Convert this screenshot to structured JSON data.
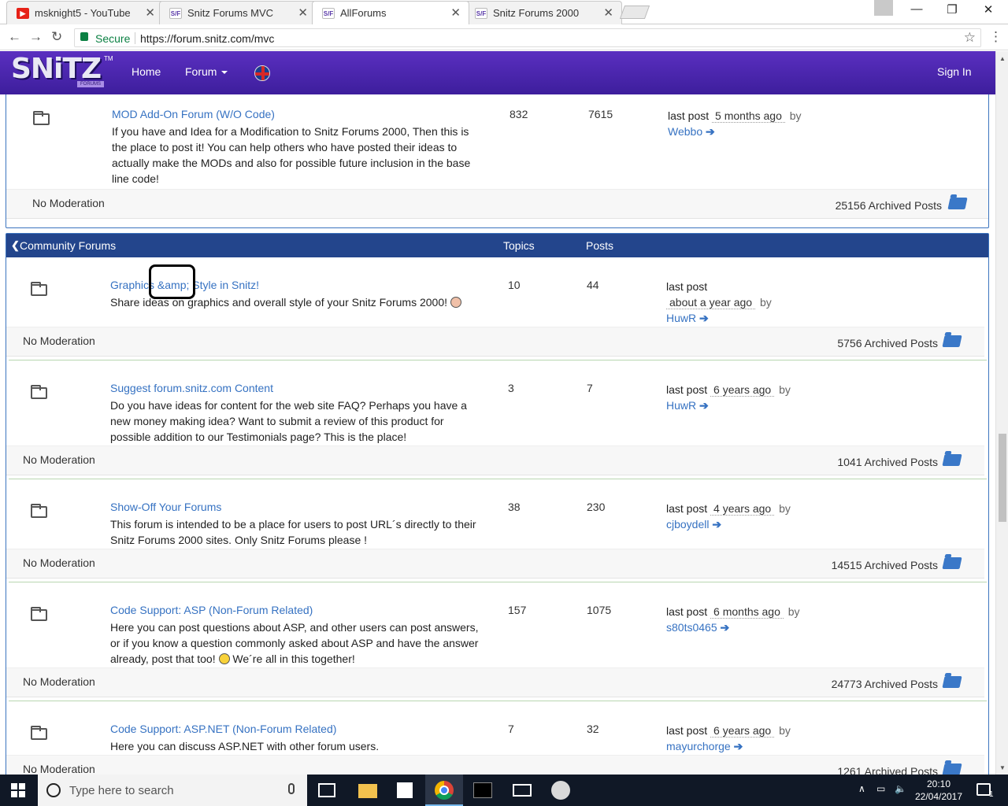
{
  "browser": {
    "tabs": [
      {
        "label": "msknight5 - YouTube",
        "favicon": "youtube-icon"
      },
      {
        "label": "Snitz Forums MVC",
        "favicon": "snitz-icon"
      },
      {
        "label": "AllForums",
        "favicon": "snitz-icon",
        "active": true
      },
      {
        "label": "Snitz Forums 2000",
        "favicon": "snitz-icon"
      }
    ],
    "close_glyph": "✕",
    "favicon_text_yt": "▶",
    "favicon_text_sf": "S/F",
    "secure_label": "Secure",
    "url": "https://forum.snitz.com/mvc"
  },
  "site": {
    "logo_text": "SNiTZ",
    "logo_sub": "FORUMS",
    "logo_tm": "TM",
    "nav": {
      "home": "Home",
      "forum": "Forum",
      "sign_in": "Sign In"
    }
  },
  "top_forum": {
    "title": "MOD Add-On Forum (W/O Code)",
    "description": "If you have and Idea for a Modification to Snitz Forums 2000, Then this is the place to post it! You can help others who have posted their ideas to actually make the MODs and also for possible future inclusion in the base line code!",
    "topics": "832",
    "posts": "7615",
    "last_post_label": "last post",
    "last_post_ago": "5 months ago",
    "by": "by",
    "author": "Webbo",
    "moderation": "No Moderation",
    "archived": "25156 Archived Posts"
  },
  "community": {
    "title": "Community Forums",
    "col_topics": "Topics",
    "col_posts": "Posts",
    "forums": [
      {
        "title": "Graphics &amp; Style in Snitz!",
        "description": "Share ideas on graphics and overall style of your Snitz Forums 2000!",
        "topics": "10",
        "posts": "44",
        "last_post_label": "last post",
        "last_post_ago": "about a year ago",
        "by": "by",
        "author": "HuwR",
        "moderation": "No Moderation",
        "archived": "5756 Archived Posts"
      },
      {
        "title": "Suggest forum.snitz.com Content",
        "description": "Do you have ideas for content for the web site FAQ? Perhaps you have a new money making idea? Want to submit a review of this product for possible addition to our Testimonials page? This is the place!",
        "topics": "3",
        "posts": "7",
        "last_post_label": "last post",
        "last_post_ago": "6 years ago",
        "by": "by",
        "author": "HuwR",
        "moderation": "No Moderation",
        "archived": "1041 Archived Posts"
      },
      {
        "title": "Show-Off Your Forums",
        "description": "This forum is intended to be a place for users to post URL´s directly to their Snitz Forums 2000 sites. Only Snitz Forums please !",
        "topics": "38",
        "posts": "230",
        "last_post_label": "last post",
        "last_post_ago": "4 years ago",
        "by": "by",
        "author": "cjboydell",
        "moderation": "No Moderation",
        "archived": "14515 Archived Posts"
      },
      {
        "title": "Code Support: ASP (Non-Forum Related)",
        "description_a": "Here you can post questions about ASP, and other users can post answers, or if you know a question commonly asked about ASP and have the answer already, post that too!",
        "description_b": "We´re all in this together!",
        "topics": "157",
        "posts": "1075",
        "last_post_label": "last post",
        "last_post_ago": "6 months ago",
        "by": "by",
        "author": "s80ts0465",
        "moderation": "No Moderation",
        "archived": "24773 Archived Posts"
      },
      {
        "title": "Code Support: ASP.NET (Non-Forum Related)",
        "description": "Here you can discuss ASP.NET with other forum users.",
        "topics": "7",
        "posts": "32",
        "last_post_label": "last post",
        "last_post_ago": "6 years ago",
        "by": "by",
        "author": "mayurchorge",
        "moderation": "No Moderation",
        "archived": "1261 Archived Posts"
      }
    ]
  },
  "taskbar": {
    "search_placeholder": "Type here to search",
    "time": "20:10",
    "date": "22/04/2017",
    "notification_count": "1"
  }
}
